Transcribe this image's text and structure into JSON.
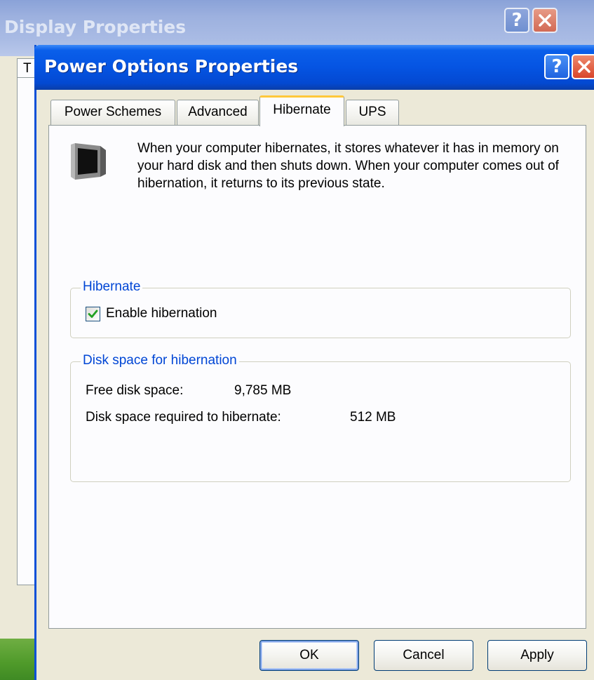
{
  "background_window": {
    "title": "Display Properties",
    "tab_stub_label": "T",
    "help_glyph": "?"
  },
  "dialog": {
    "title": "Power Options Properties",
    "help_glyph": "?",
    "tabs": [
      {
        "label": "Power Schemes",
        "active": false
      },
      {
        "label": "Advanced",
        "active": false
      },
      {
        "label": "Hibernate",
        "active": true
      },
      {
        "label": "UPS",
        "active": false
      }
    ],
    "info_icon": "monitor-moon-icon",
    "info_text": "When your computer hibernates, it stores whatever it has in memory on your hard disk and then shuts down. When your computer comes out of hibernation, it returns to its previous state.",
    "hibernate_group": {
      "legend": "Hibernate",
      "checkbox_label": "Enable hibernation",
      "checked": true
    },
    "disk_group": {
      "legend": "Disk space for hibernation",
      "free_label": "Free disk space:",
      "free_value": "9,785 MB",
      "required_label": "Disk space required to hibernate:",
      "required_value": "512 MB"
    },
    "buttons": {
      "ok": "OK",
      "cancel": "Cancel",
      "apply": "Apply"
    }
  },
  "colors": {
    "titlebar_blue": "#0554e2",
    "groupbox_legend": "#0046d5",
    "active_tab_accent": "#ffc83c",
    "close_red": "#d8452a",
    "checkmark_green": "#21a121"
  }
}
